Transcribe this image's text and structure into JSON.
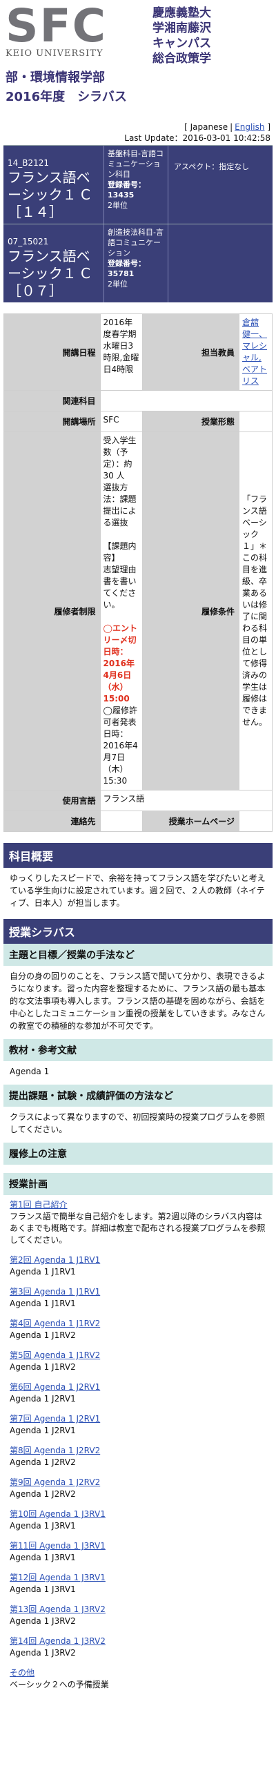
{
  "header": {
    "logo_letters": "SFC",
    "logo_sub": "KEIO UNIVERSITY",
    "campus_lines": [
      "慶應義塾大",
      "学湘南藤沢",
      "キャンパス",
      "総合政策学"
    ],
    "dept": "部・環境情報学部",
    "year_title": "2016年度　シラバス"
  },
  "meta": {
    "lang_japanese": "Japanese",
    "lang_english": "English",
    "last_update_label": "Last Update：",
    "last_update_value": "2016-03-01 10:42:58"
  },
  "courses": [
    {
      "code": "14_B2121",
      "title": "フランス語ベーシック１ C［１４］",
      "category": "基盤科目-言語コミュニケーション科目",
      "reg_label": "登録番号：",
      "reg_number": "13435",
      "credits": "2単位",
      "aspect": "アスペクト：指定なし"
    },
    {
      "code": "07_15021",
      "title": "フランス語ベーシック１ C［０７］",
      "category": "創造技法科目-言語コミュニケーション",
      "reg_label": "登録番号：",
      "reg_number": "35781",
      "credits": "2単位",
      "aspect": ""
    }
  ],
  "info": {
    "schedule_label": "開講日程",
    "schedule_value": "2016年度春学期水曜日3時限,金曜日4時限",
    "instructor_label": "担当教員",
    "instructor_value": "倉舘 健一、マレシャル, ベアトリス",
    "related_label": "関連科目",
    "related_value": "",
    "location_label": "開講場所",
    "location_value": "SFC",
    "format_label": "授業形態",
    "format_value": "",
    "restriction_label": "履修者制限",
    "restriction_text1": "受入学生数（予定）：約 30 人",
    "restriction_text2": "選抜方法：課題提出による選抜",
    "restriction_text3": "【課題内容】",
    "restriction_text4": "志望理由書を書いてください。",
    "restriction_red": "◯エントリー〆切日時：2016年4月6日（水）15:00",
    "restriction_text5": "◯履修許可者発表日時：2016年4月7日（木）15:30",
    "condition_label": "履修条件",
    "condition_value": "「フランス語ベーシック１」＊この科目を進級、卒業あるいは修了に関わる科目の単位として修得済みの学生は履修はできません。",
    "language_label": "使用言語",
    "language_value": "フランス語",
    "contact_label": "連絡先",
    "contact_value": "",
    "homepage_label": "授業ホームページ",
    "homepage_value": ""
  },
  "overview": {
    "title": "科目概要",
    "text": "ゆっくりしたスピードで、余裕を持ってフランス語を学びたいと考えている学生向けに設定されています。週２回で、２人の教師（ネイティブ、日本人）が担当します。"
  },
  "syllabus": {
    "title": "授業シラバス",
    "goals_title": "主題と目標／授業の手法など",
    "goals_text": "自分の身の回りのことを、フランス語で聞いて分かり、表現できるようになります。習った内容を整理するために、フランス語の最も基本的な文法事項も導入します。フランス語の基礎を固めながら、会話を中心としたコミュニケーション重視の授業をしていきます。みなさんの教室での積極的な参加が不可欠です。",
    "textbook_title": "教材・参考文献",
    "textbook_text": "Agenda 1",
    "assessment_title": "提出課題・試験・成績評価の方法など",
    "assessment_text": "クラスによって異なりますので、初回授業時の授業プログラムを参照してください。",
    "notes_title": "履修上の注意",
    "plan_title": "授業計画"
  },
  "plan": [
    {
      "title": "第1回 自己紹介",
      "desc": "フランス語で簡単な自己紹介をします。第2週以降のシラバス内容はあくまでも概略です。詳細は教室で配布される授業プログラムを参照してください。"
    },
    {
      "title": "第2回 Agenda 1 J1RV1",
      "desc": "Agenda 1 J1RV1"
    },
    {
      "title": "第3回 Agenda 1 J1RV1",
      "desc": "Agenda 1 J1RV1"
    },
    {
      "title": "第4回 Agenda 1 J1RV2",
      "desc": "Agenda 1 J1RV2"
    },
    {
      "title": "第5回 Agenda 1 J1RV2",
      "desc": "Agenda 1 J1RV2"
    },
    {
      "title": "第6回 Agenda 1 J2RV1",
      "desc": "Agenda 1 J2RV1"
    },
    {
      "title": "第7回 Agenda 1 J2RV1",
      "desc": "Agenda 1 J2RV1"
    },
    {
      "title": "第8回 Agenda 1 J2RV2",
      "desc": "Agenda 1 J2RV2"
    },
    {
      "title": "第9回 Agenda 1 J2RV2",
      "desc": "Agenda 1 J2RV2"
    },
    {
      "title": "第10回 Agenda 1 J3RV1",
      "desc": "Agenda 1 J3RV1"
    },
    {
      "title": "第11回 Agenda 1 J3RV1",
      "desc": "Agenda 1 J3RV1"
    },
    {
      "title": "第12回 Agenda 1 J3RV1",
      "desc": "Agenda 1 J3RV1"
    },
    {
      "title": "第13回 Agenda 1 J3RV2",
      "desc": "Agenda 1 J3RV2"
    },
    {
      "title": "第14回 Agenda 1 J3RV2",
      "desc": "Agenda 1 J3RV2"
    },
    {
      "title": "その他",
      "desc": "ベーシック２への予備授業"
    }
  ]
}
